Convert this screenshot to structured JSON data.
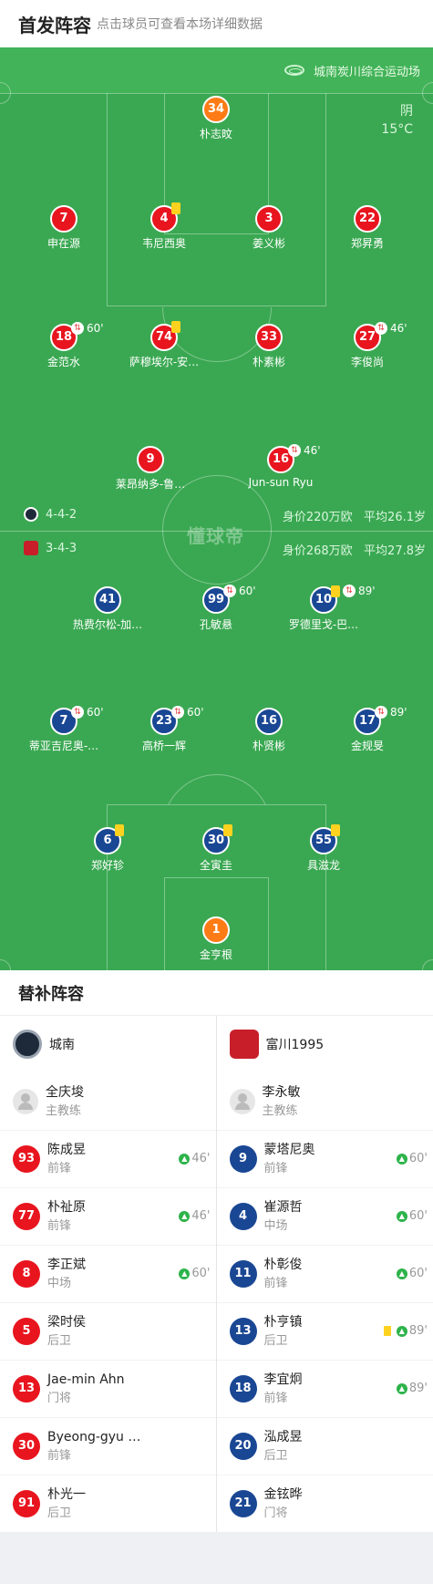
{
  "header": {
    "title": "首发阵容",
    "subtitle": "点击球员可查看本场详细数据"
  },
  "venue": {
    "name": "城南炭川综合运动场"
  },
  "weather": {
    "cond": "阴",
    "temp": "15°C"
  },
  "watermark": "懂球帝",
  "home_form": {
    "formation": "4-4-2",
    "value": "身价220万欧",
    "age": "平均26.1岁"
  },
  "away_form": {
    "formation": "3-4-3",
    "value": "身价268万欧",
    "age": "平均27.8岁"
  },
  "home_players": [
    {
      "num": "34",
      "name": "朴志旼",
      "color": "orange"
    },
    {
      "num": "7",
      "name": "申在源"
    },
    {
      "num": "4",
      "name": "韦尼西奥",
      "yellow": true
    },
    {
      "num": "3",
      "name": "姜义彬"
    },
    {
      "num": "22",
      "name": "郑昇勇"
    },
    {
      "num": "18",
      "name": "金范水",
      "sub": "60'"
    },
    {
      "num": "74",
      "name": "萨穆埃尔-安…",
      "yellow": true
    },
    {
      "num": "33",
      "name": "朴素彬"
    },
    {
      "num": "27",
      "name": "李俊尚",
      "sub": "46'"
    },
    {
      "num": "9",
      "name": "莱昂纳多-鲁…"
    },
    {
      "num": "16",
      "name": "Jun-sun Ryu",
      "sub": "46'"
    }
  ],
  "away_players": [
    {
      "num": "41",
      "name": "热费尔松-加…"
    },
    {
      "num": "99",
      "name": "孔敏悬",
      "sub": "60'"
    },
    {
      "num": "10",
      "name": "罗德里戈-巴…",
      "yellow": true,
      "sub": "89'"
    },
    {
      "num": "7",
      "name": "蒂亚吉尼奥-…",
      "sub": "60'"
    },
    {
      "num": "23",
      "name": "高桥一辉",
      "sub": "60'"
    },
    {
      "num": "16",
      "name": "朴贤彬"
    },
    {
      "num": "17",
      "name": "金规旻",
      "sub": "89'"
    },
    {
      "num": "6",
      "name": "郑好轸",
      "yellow": true
    },
    {
      "num": "30",
      "name": "全寅圭",
      "yellow": true
    },
    {
      "num": "55",
      "name": "具滋龙",
      "yellow": true
    },
    {
      "num": "1",
      "name": "金亨根",
      "color": "orange"
    }
  ],
  "subs": {
    "title": "替补阵容",
    "home": {
      "team": "城南",
      "coach": {
        "name": "全庆埈",
        "role": "主教练"
      },
      "players": [
        {
          "num": "93",
          "name": "陈成昱",
          "pos": "前锋",
          "in": "46'"
        },
        {
          "num": "77",
          "name": "朴祉原",
          "pos": "前锋",
          "in": "46'"
        },
        {
          "num": "8",
          "name": "李正斌",
          "pos": "中场",
          "in": "60'"
        },
        {
          "num": "5",
          "name": "梁时侯",
          "pos": "后卫"
        },
        {
          "num": "13",
          "name": "Jae-min Ahn",
          "pos": "门将"
        },
        {
          "num": "30",
          "name": "Byeong-gyu …",
          "pos": "前锋"
        },
        {
          "num": "91",
          "name": "朴光一",
          "pos": "后卫"
        }
      ]
    },
    "away": {
      "team": "富川1995",
      "coach": {
        "name": "李永敏",
        "role": "主教练"
      },
      "players": [
        {
          "num": "9",
          "name": "蒙塔尼奥",
          "pos": "前锋",
          "in": "60'"
        },
        {
          "num": "4",
          "name": "崔源哲",
          "pos": "中场",
          "in": "60'"
        },
        {
          "num": "11",
          "name": "朴彰俊",
          "pos": "前锋",
          "in": "60'"
        },
        {
          "num": "13",
          "name": "朴亨镇",
          "pos": "后卫",
          "in": "89'",
          "yellow": true
        },
        {
          "num": "18",
          "name": "李宜炯",
          "pos": "前锋",
          "in": "89'"
        },
        {
          "num": "20",
          "name": "泓成昱",
          "pos": "后卫"
        },
        {
          "num": "21",
          "name": "金铉晔",
          "pos": "门将"
        }
      ]
    }
  },
  "colors": {
    "pitch": "#3aa852",
    "home": "#e8151f",
    "away": "#1a4794",
    "gk": "#ff7b16"
  }
}
